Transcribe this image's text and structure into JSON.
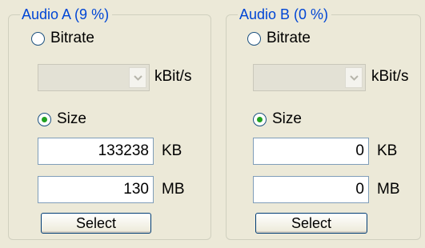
{
  "groups": [
    {
      "title": "Audio A (9 %)",
      "bitrate_label": "Bitrate",
      "bitrate_unit": "kBit/s",
      "size_label": "Size",
      "size_kb": "133238",
      "kb_unit": "KB",
      "size_mb": "130",
      "mb_unit": "MB",
      "select_label": "Select"
    },
    {
      "title": "Audio B (0 %)",
      "bitrate_label": "Bitrate",
      "bitrate_unit": "kBit/s",
      "size_label": "Size",
      "size_kb": "0",
      "kb_unit": "KB",
      "size_mb": "0",
      "mb_unit": "MB",
      "select_label": "Select"
    }
  ],
  "icons": {
    "dropdown": "chevron-down-icon"
  }
}
